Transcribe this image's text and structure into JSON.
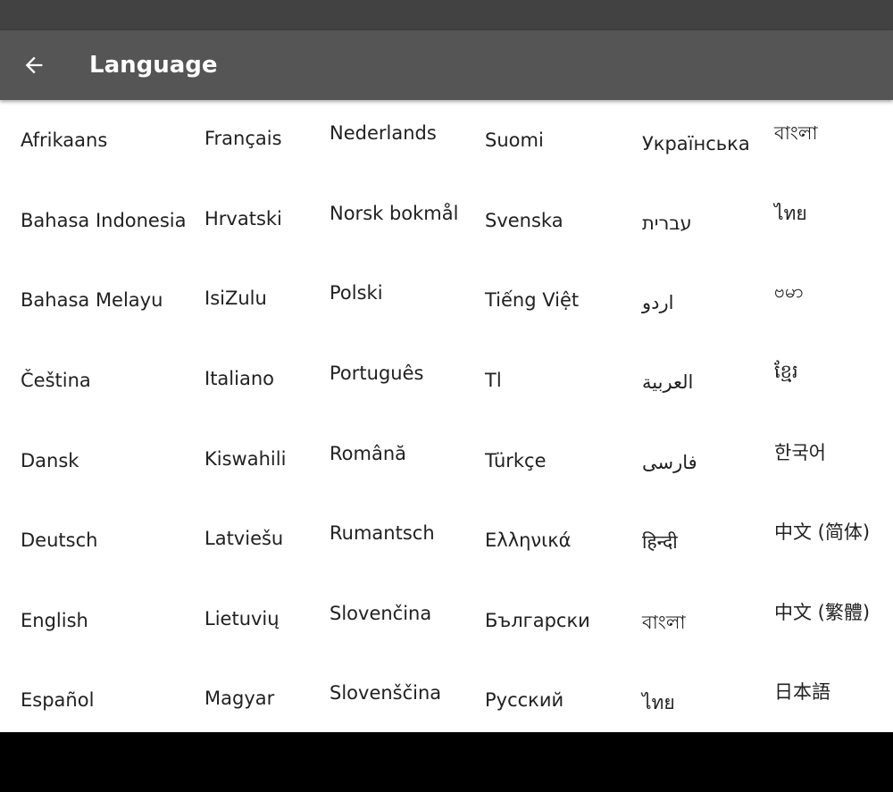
{
  "app_bar": {
    "title": "Language",
    "back_icon": "arrow-left-icon"
  },
  "columns": [
    [
      "Afrikaans",
      "Bahasa Indonesia",
      "Bahasa Melayu",
      "Čeština",
      "Dansk",
      "Deutsch",
      "English",
      "Español"
    ],
    [
      "Français",
      "Hrvatski",
      "IsiZulu",
      "Italiano",
      "Kiswahili",
      "Latviešu",
      "Lietuvių",
      "Magyar"
    ],
    [
      "Nederlands",
      "Norsk bokmål",
      "Polski",
      "Português",
      "Română",
      "Rumantsch",
      "Slovenčina",
      "Slovenščina"
    ],
    [
      "Suomi",
      "Svenska",
      "Tiếng Việt",
      "Tl",
      "Türkçe",
      "Ελληνικά",
      "Български",
      "Русский"
    ],
    [
      "Українська",
      "עברית",
      "اردو",
      "العربية",
      "فارسی",
      "हिन्दी",
      "বাংলা",
      "ไทย"
    ],
    [
      "বাংলা",
      "ไทย",
      "ဗမာ",
      "ខ្មែរ",
      "한국어",
      "中文 (简体)",
      "中文 (繁體)",
      "日本語"
    ]
  ],
  "colors": {
    "status_bar": "#424242",
    "app_bar": "#555555",
    "text": "#212121",
    "background": "#ffffff"
  }
}
